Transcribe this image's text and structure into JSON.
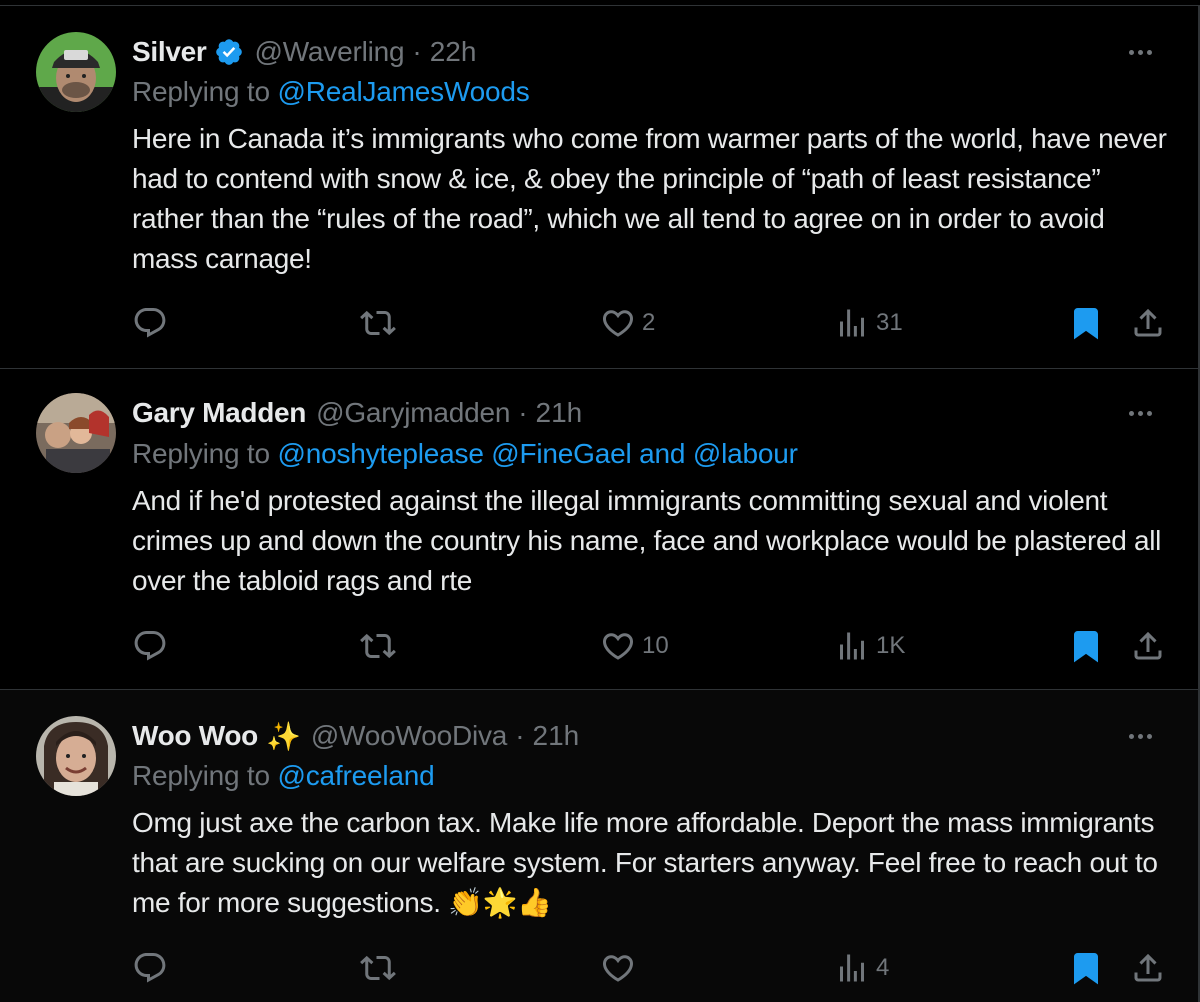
{
  "tweets": [
    {
      "name": "Silver",
      "verified": true,
      "handle": "@Waverling",
      "time": "22h",
      "replying_label": "Replying to",
      "mentions": [
        "@RealJamesWoods"
      ],
      "joiner": "",
      "body": "Here in Canada it’s immigrants who come from warmer parts of the world, have never had to contend with snow & ice, & obey the principle of “path of least resistance” rather than the “rules of the road”, which we all tend to agree on in order to avoid mass carnage!",
      "replies": "",
      "reposts": "",
      "likes": "2",
      "views": "31",
      "bookmarked": true
    },
    {
      "name": "Gary Madden",
      "verified": false,
      "handle": "@Garyjmadden",
      "time": "21h",
      "replying_label": "Replying to",
      "mentions": [
        "@noshyteplease",
        "@FineGael",
        "@labour"
      ],
      "joiner": "and",
      "body": "And if he'd protested against the illegal immigrants committing sexual and violent crimes up and down the country his name, face and workplace would be plastered all over the tabloid rags and rte",
      "replies": "",
      "reposts": "",
      "likes": "10",
      "views": "1K",
      "bookmarked": true
    },
    {
      "name": "Woo Woo",
      "name_emoji": "✨",
      "verified": false,
      "handle": "@WooWooDiva",
      "time": "21h",
      "replying_label": "Replying to",
      "mentions": [
        "@cafreeland"
      ],
      "joiner": "",
      "body": "Omg just axe the carbon tax. Make life more affordable. Deport the mass immigrants that are sucking on our welfare system. For starters anyway. Feel free to reach out to me for more suggestions.",
      "body_emoji": "👏🌟👍",
      "replies": "",
      "reposts": "",
      "likes": "",
      "views": "4",
      "bookmarked": true
    }
  ],
  "colors": {
    "background": "#000000",
    "text": "#e7e9ea",
    "secondary": "#71767b",
    "accent": "#1d9bf0",
    "divider": "#2f3336"
  },
  "icons": [
    "verified-badge-icon",
    "more-icon",
    "reply-icon",
    "repost-icon",
    "like-icon",
    "views-icon",
    "bookmark-icon",
    "share-icon",
    "sparkles-icon"
  ]
}
